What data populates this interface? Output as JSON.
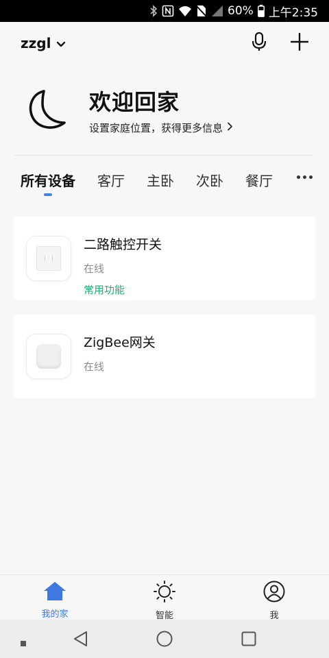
{
  "status_bar": {
    "battery_text": "60%",
    "time": "上午2:35"
  },
  "header": {
    "home_name": "zzgl"
  },
  "welcome": {
    "title": "欢迎回家",
    "subtitle": "设置家庭位置，获得更多信息"
  },
  "tabs": [
    {
      "label": "所有设备",
      "active": true
    },
    {
      "label": "客厅"
    },
    {
      "label": "主卧"
    },
    {
      "label": "次卧"
    },
    {
      "label": "餐厅"
    }
  ],
  "devices": [
    {
      "name": "二路触控开关",
      "status": "在线",
      "function": "常用功能"
    },
    {
      "name": "ZigBee网关",
      "status": "在线"
    }
  ],
  "bottom_nav": [
    {
      "label": "我的家",
      "active": true
    },
    {
      "label": "智能"
    },
    {
      "label": "我"
    }
  ],
  "colors": {
    "accent": "#3f78e0",
    "function_green": "#1fae6f",
    "status_gray": "#8c8c8c"
  },
  "icons": [
    "bluetooth-icon",
    "nfc-icon",
    "wifi-icon",
    "no-sim-icon",
    "signal-icon",
    "battery-icon",
    "chevron-down-icon",
    "microphone-icon",
    "plus-icon",
    "moon-icon",
    "chevron-right-icon",
    "more-icon",
    "home-icon",
    "sun-icon",
    "user-icon",
    "back-icon",
    "home-circle-icon",
    "recents-icon"
  ]
}
